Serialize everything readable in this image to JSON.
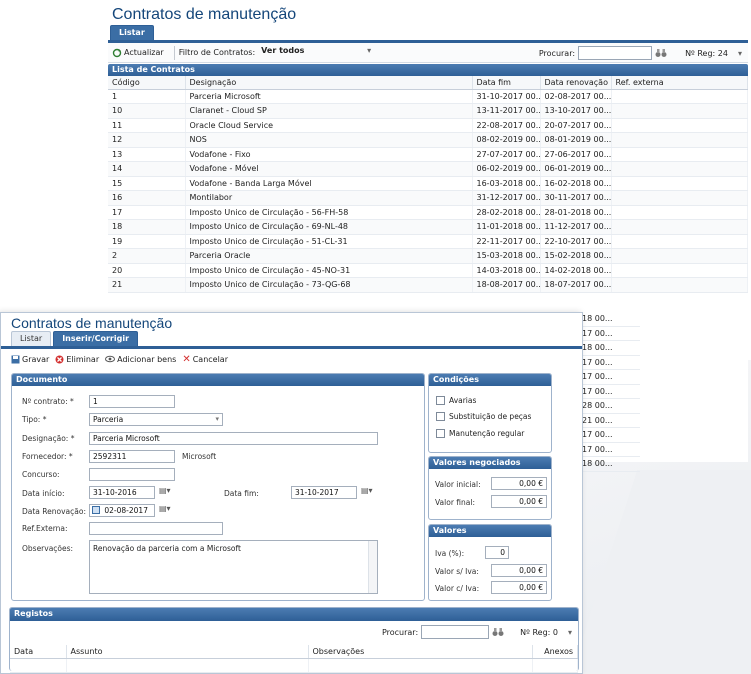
{
  "list_window": {
    "title": "Contratos de manutenção",
    "tabs": [
      "Listar"
    ],
    "toolbar": {
      "refresh_label": "Actualizar",
      "filter_label": "Filtro de Contratos:",
      "filter_value": "Ver todos",
      "search_label": "Procurar:",
      "nreg_label": "Nº Reg: 24"
    },
    "panel_title": "Lista de Contratos",
    "columns": [
      "Código",
      "Designação",
      "Data fim",
      "Data renovação",
      "Ref. externa"
    ],
    "rows": [
      [
        "1",
        "Parceria Microsoft",
        "31-10-2017 00...",
        "02-08-2017 00..."
      ],
      [
        "10",
        "Claranet - Cloud SP",
        "13-11-2017 00...",
        "13-10-2017 00..."
      ],
      [
        "11",
        "Oracle Cloud Service",
        "22-08-2017 00...",
        "20-07-2017 00..."
      ],
      [
        "12",
        "NOS",
        "08-02-2019 00...",
        "08-01-2019 00..."
      ],
      [
        "13",
        "Vodafone - Fixo",
        "27-07-2017 00...",
        "27-06-2017 00..."
      ],
      [
        "14",
        "Vodafone - Móvel",
        "06-02-2019 00...",
        "06-01-2019 00..."
      ],
      [
        "15",
        "Vodafone - Banda Larga Móvel",
        "16-03-2018 00...",
        "16-02-2018 00..."
      ],
      [
        "16",
        "Montilabor",
        "31-12-2017 00...",
        "30-11-2017 00..."
      ],
      [
        "17",
        "Imposto Unico de Circulação - 56-FH-58",
        "28-02-2018 00...",
        "28-01-2018 00..."
      ],
      [
        "18",
        "Imposto Unico de Circulação - 69-NL-48",
        "11-01-2018 00...",
        "11-12-2017 00..."
      ],
      [
        "19",
        "Imposto Unico de Circulação - 51-CL-31",
        "22-11-2017 00...",
        "22-10-2017 00..."
      ],
      [
        "2",
        "Parceria Oracle",
        "15-03-2018 00...",
        "15-02-2018 00..."
      ],
      [
        "20",
        "Imposto Unico de Circulação - 45-NO-31",
        "14-03-2018 00...",
        "14-02-2018 00..."
      ],
      [
        "21",
        "Imposto Unico de Circulação - 73-QG-68",
        "18-08-2017 00...",
        "18-07-2017 00..."
      ]
    ],
    "hidden_dates": [
      "18 00...",
      "17 00...",
      "18 00...",
      "17 00...",
      "17 00...",
      "17 00...",
      "28 00...",
      "21 00...",
      "17 00...",
      "17 00...",
      "18 00..."
    ]
  },
  "edit_window": {
    "title": "Contratos de manutenção",
    "tabs": [
      "Listar",
      "Inserir/Corrigir"
    ],
    "toolbar": {
      "save_label": "Gravar",
      "delete_label": "Eliminar",
      "add_goods_label": "Adicionar bens",
      "cancel_label": "Cancelar"
    },
    "documento": {
      "title": "Documento",
      "contract_no_label": "Nº contrato: *",
      "contract_no_value": "1",
      "type_label": "Tipo: *",
      "type_value": "Parceria",
      "designation_label": "Designação: *",
      "designation_value": "Parceria Microsoft",
      "supplier_label": "Fornecedor: *",
      "supplier_value": "2592311",
      "supplier_name": "Microsoft",
      "tender_label": "Concurso:",
      "tender_value": "",
      "start_label": "Data início:",
      "start_value": "31-10-2016",
      "end_label": "Data fim:",
      "end_value": "31-10-2017",
      "renewal_label": "Data Renovação:",
      "renewal_value": "02-08-2017",
      "extref_label": "Ref.Externa:",
      "extref_value": "",
      "notes_label": "Observações:",
      "notes_value": "Renovação da parceria com a Microsoft"
    },
    "condicoes": {
      "title": "Condições",
      "items": [
        "Avarias",
        "Substituição de peças",
        "Manutenção regular"
      ]
    },
    "valores_negociados": {
      "title": "Valores negociados",
      "initial_label": "Valor inicial:",
      "initial_value": "0,00 €",
      "final_label": "Valor final:",
      "final_value": "0,00 €"
    },
    "valores": {
      "title": "Valores",
      "iva_label": "Iva (%):",
      "iva_value": "0",
      "no_iva_label": "Valor s/ Iva:",
      "no_iva_value": "0,00 €",
      "with_iva_label": "Valor c/ Iva:",
      "with_iva_value": "0,00 €"
    },
    "registos": {
      "title": "Registos",
      "search_label": "Procurar:",
      "nreg_label": "Nº Reg: 0",
      "columns": [
        "Data",
        "Assunto",
        "Observações",
        "Anexos"
      ]
    }
  },
  "colors": {
    "accent": "#2e5f96",
    "title": "#14467a"
  }
}
